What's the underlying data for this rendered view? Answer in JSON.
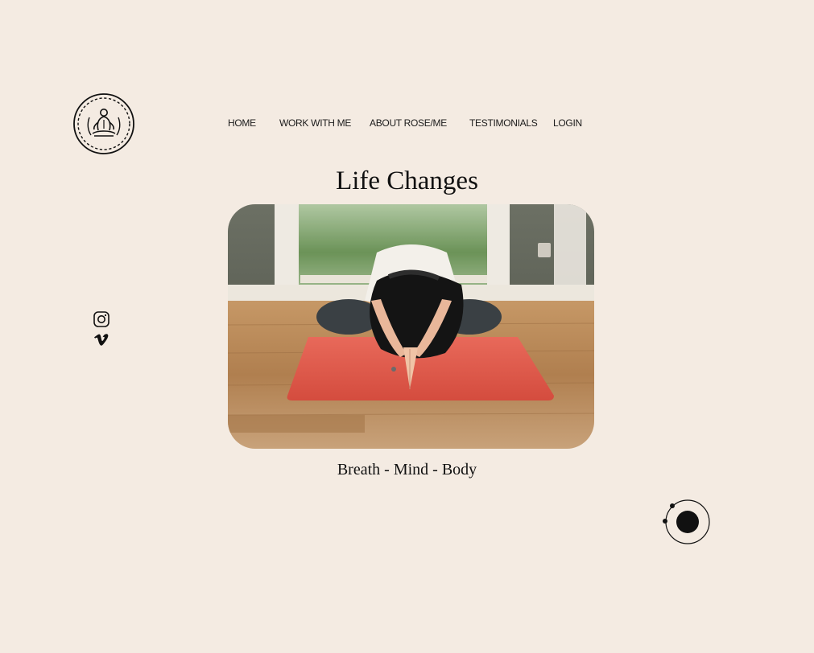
{
  "logo": {
    "icon": "meditation-logo-icon"
  },
  "nav": {
    "items": [
      {
        "label": "HOME"
      },
      {
        "label": "WORK WITH ME"
      },
      {
        "label": "ABOUT ROSE/ME"
      },
      {
        "label": "TESTIMONIALS"
      },
      {
        "label": "LOGIN"
      }
    ]
  },
  "main": {
    "title": "Life Changes",
    "tagline": "Breath - Mind - Body"
  },
  "social": {
    "links": [
      {
        "icon": "instagram-icon"
      },
      {
        "icon": "vimeo-icon"
      }
    ]
  },
  "widget": {
    "icon": "orbit-chat-icon"
  },
  "colors": {
    "background": "#f4ebe2",
    "text": "#111111",
    "mat": "#e0584a",
    "floor": "#b07f4f"
  }
}
